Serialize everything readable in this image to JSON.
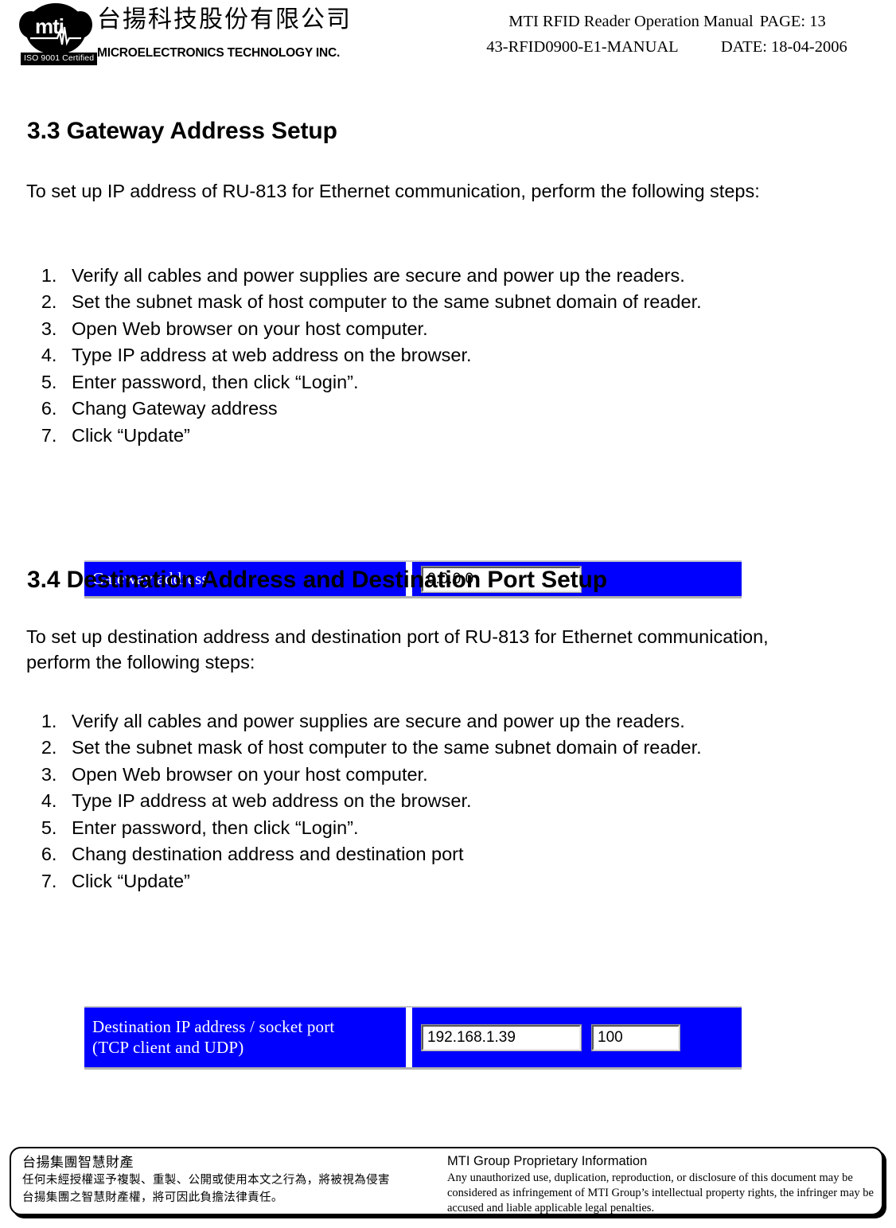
{
  "header": {
    "logo": {
      "icon": "mti-cloud-logo",
      "wordmark": "mti",
      "iso_badge": "ISO 9001 Certified"
    },
    "company_name_cn": "台揚科技股份有限公司",
    "company_name_en": "MICROELECTRONICS TECHNOLOGY INC.",
    "manual_title": "MTI  RFID  Reader   Operation  Manual",
    "page_label": "PAGE:  13",
    "doc_number": "43-RFID0900-E1-MANUAL",
    "date_label": "DATE: 18-04-2006"
  },
  "sections": [
    {
      "heading": "3.3 Gateway Address Setup",
      "intro": "To set up IP address of RU-813 for Ethernet communication, perform the following steps:",
      "steps": [
        "Verify all cables and power supplies are secure and power up the readers.",
        "Set the subnet mask of host computer to the same subnet domain of reader.",
        "Open Web browser on your host computer.",
        "Type IP address at web address on the browser.",
        "Enter password, then click “Login”.",
        "Chang Gateway address",
        "Click “Update”"
      ],
      "form": {
        "label_line1": "Gateway address",
        "label_line2": "",
        "fields": [
          {
            "name": "gateway-address-input",
            "value": "0.0.0.0"
          }
        ]
      }
    },
    {
      "heading": "3.4 Destination Address and Destination Port Setup",
      "intro": "To set up destination address and destination port of RU-813 for Ethernet communication, perform the following steps:",
      "steps": [
        "Verify all cables and power supplies are secure and power up the readers.",
        "Set the subnet mask of host computer to the same subnet domain of reader.",
        "Open Web browser on your host computer.",
        "Type IP address at web address on the browser.",
        "Enter password, then click “Login”.",
        "Chang destination address and destination port",
        "Click “Update”"
      ],
      "form": {
        "label_line1": "Destination IP address / socket port",
        "label_line2": "(TCP client and UDP)",
        "fields": [
          {
            "name": "destination-ip-input",
            "value": "192.168.1.39"
          },
          {
            "name": "destination-port-input",
            "value": "100"
          }
        ]
      }
    }
  ],
  "footer": {
    "left_title": "台揚集團智慧財產",
    "left_line1": "任何未經授權逕予複製、重製、公開或使用本文之行為，將被視為侵害",
    "left_line2": "台揚集團之智慧財產權，將可因此負擔法律責任。",
    "right_title": "MTI Group Proprietary Information",
    "right_body": "Any unauthorized use, duplication, reproduction, or disclosure of this document may be considered as infringement of MTI Group’s intellectual property rights, the infringer may be accused and liable applicable legal penalties."
  },
  "colors": {
    "form_background": "#0000FF",
    "form_label_text": "#FFFFFF",
    "page_background": "#FFFFFF",
    "text": "#000000"
  }
}
